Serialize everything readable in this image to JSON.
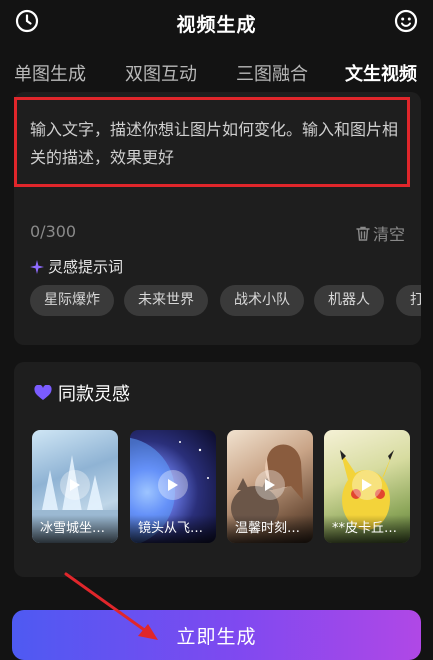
{
  "header": {
    "title": "视频生成",
    "left_icon": "clock-icon",
    "right_icon": "smile-icon"
  },
  "tabs": [
    {
      "label": "单图生成",
      "active": false
    },
    {
      "label": "双图互动",
      "active": false
    },
    {
      "label": "三图融合",
      "active": false
    },
    {
      "label": "文生视频",
      "active": true
    }
  ],
  "prompt": {
    "placeholder": "输入文字，描述你想让图片如何变化。输入和图片相关的描述，效果更好",
    "counter": "0/300",
    "clear_label": "清空"
  },
  "inspiration": {
    "title": "灵感提示词",
    "chips": [
      "星际爆炸",
      "未来世界",
      "战术小队",
      "机器人",
      "打"
    ]
  },
  "same_style": {
    "title": "同款灵感",
    "cards": [
      {
        "caption": "冰雪城坐…"
      },
      {
        "caption": "镜头从飞…"
      },
      {
        "caption": "温馨时刻…"
      },
      {
        "caption": "**皮卡丘…"
      }
    ]
  },
  "generate_button": {
    "label": "立即生成"
  },
  "colors": {
    "accent_gradient_start": "#4e5af2",
    "accent_gradient_end": "#b048e6",
    "highlight": "#e0262b"
  }
}
